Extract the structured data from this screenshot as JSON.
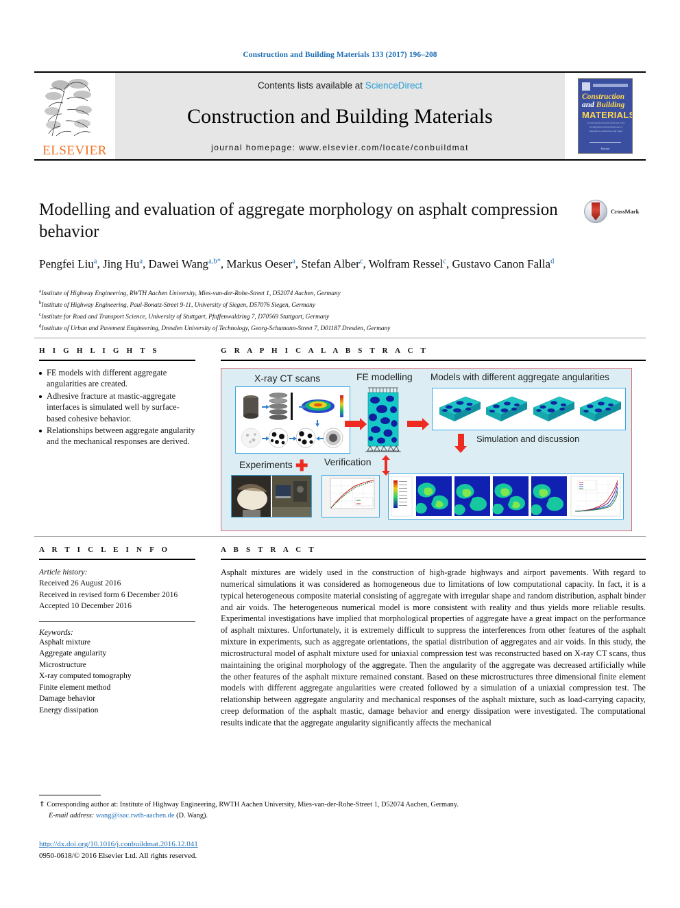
{
  "journal_ref": "Construction and Building Materials 133 (2017) 196–208",
  "masthead": {
    "contents_prefix": "Contents lists available at ",
    "sciencedirect": "ScienceDirect",
    "journal_name": "Construction and Building Materials",
    "homepage": "journal homepage: www.elsevier.com/locate/conbuildmat",
    "publisher": "ELSEVIER",
    "cover": {
      "line1": "Construction",
      "line2_a": "and ",
      "line2_b": "Building",
      "line3": "MATERIALS",
      "blurb": "An international journal dedicated to the investigation and innovative use of materials in construction and repair",
      "foot": "Elsevier"
    }
  },
  "title": "Modelling and evaluation of aggregate morphology on asphalt compression behavior",
  "crossmark_label": "CrossMark",
  "authors": [
    {
      "name": "Pengfei Liu",
      "sup": "a",
      "sep": ", "
    },
    {
      "name": "Jing Hu",
      "sup": "a",
      "sep": ", "
    },
    {
      "name": "Dawei Wang",
      "sup": "a,b",
      "star": "*",
      "sep": ", "
    },
    {
      "name": "Markus Oeser",
      "sup": "a",
      "sep": ", "
    },
    {
      "name": "Stefan Alber",
      "sup": "c",
      "sep": ", "
    },
    {
      "name": "Wolfram Ressel",
      "sup": "c",
      "sep": ", "
    },
    {
      "name": "Gustavo Canon Falla",
      "sup": "d",
      "sep": ""
    }
  ],
  "affiliations": [
    {
      "marker": "a",
      "text": "Institute of Highway Engineering, RWTH Aachen University, Mies-van-der-Rohe-Street 1, D52074 Aachen, Germany"
    },
    {
      "marker": "b",
      "text": "Institute of Highway Engineering, Paul-Bonatz-Street 9-11, University of Siegen, D57076 Siegen, Germany"
    },
    {
      "marker": "c",
      "text": "Institute for Road and Transport Science, University of Stuttgart, Pfaffenwaldring 7, D70569 Stuttgart, Germany"
    },
    {
      "marker": "d",
      "text": "Institute of Urban and Pavement Engineering, Dresden University of Technology, Georg-Schumann-Street 7, D01187 Dresden, Germany"
    }
  ],
  "highlights": {
    "heading": "H I G H L I G H T S",
    "items": [
      "FE models with different aggregate angularities are created.",
      "Adhesive fracture at mastic-aggregate interfaces is simulated well by surface-based cohesive behavior.",
      "Relationships between aggregate angularity and the mechanical responses are derived."
    ]
  },
  "graphical_abstract": {
    "heading": "G R A P H I C A L   A B S T R A C T",
    "labels": {
      "xray": "X-ray CT scans",
      "fe_modelling": "FE modelling",
      "models": "Models with different aggregate angularities",
      "simulation": "Simulation and discussion",
      "experiments": "Experiments",
      "verification": "Verification"
    }
  },
  "article_info": {
    "heading": "A R T I C L E   I N F O",
    "history_label": "Article history:",
    "history": [
      "Received 26 August 2016",
      "Received in revised form 6 December 2016",
      "Accepted 10 December 2016"
    ],
    "keywords_label": "Keywords:",
    "keywords": [
      "Asphalt mixture",
      "Aggregate angularity",
      "Microstructure",
      "X-ray computed tomography",
      "Finite element method",
      "Damage behavior",
      "Energy dissipation"
    ]
  },
  "abstract": {
    "heading": "A B S T R A C T",
    "text": "Asphalt mixtures are widely used in the construction of high-grade highways and airport pavements. With regard to numerical simulations it was considered as homogeneous due to limitations of low computational capacity. In fact, it is a typical heterogeneous composite material consisting of aggregate with irregular shape and random distribution, asphalt binder and air voids. The heterogeneous numerical model is more consistent with reality and thus yields more reliable results. Experimental investigations have implied that morphological properties of aggregate have a great impact on the performance of asphalt mixtures. Unfortunately, it is extremely difficult to suppress the interferences from other features of the asphalt mixture in experiments, such as aggregate orientations, the spatial distribution of aggregates and air voids. In this study, the microstructural model of asphalt mixture used for uniaxial compression test was reconstructed based on X-ray CT scans, thus maintaining the original morphology of the aggregate. Then the angularity of the aggregate was decreased artificially while the other features of the asphalt mixture remained constant. Based on these microstructures three dimensional finite element models with different aggregate angularities were created followed by a simulation of a uniaxial compression test. The relationship between aggregate angularity and mechanical responses of the asphalt mixture, such as load-carrying capacity, creep deformation of the asphalt mastic, damage behavior and energy dissipation were investigated. The computational results indicate that the aggregate angularity significantly affects the mechanical"
  },
  "footer": {
    "corresponding_marker": "⇑",
    "corresponding": "Corresponding author at: Institute of Highway Engineering, RWTH Aachen University, Mies-van-der-Rohe-Street 1, D52074 Aachen, Germany.",
    "email_label": "E-mail address:",
    "email": "wang@isac.rwth-aachen.de",
    "email_suffix": "(D. Wang).",
    "doi": "http://dx.doi.org/10.1016/j.conbuildmat.2016.12.041",
    "copyright": "0950-0618/© 2016 Elsevier Ltd. All rights reserved."
  }
}
